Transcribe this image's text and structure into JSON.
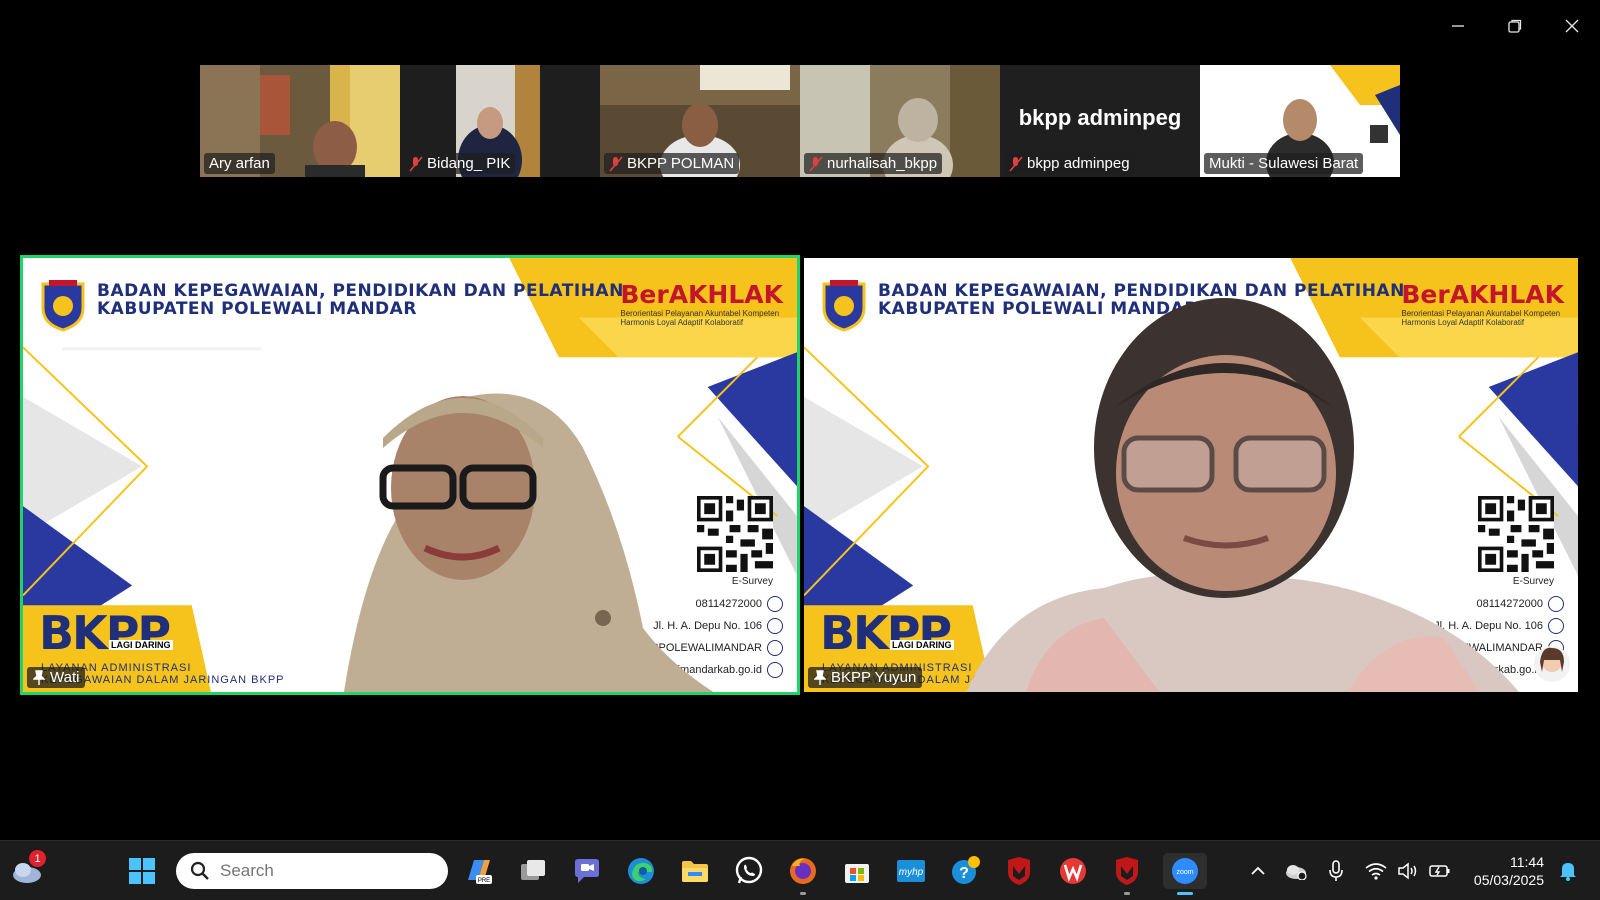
{
  "window": {
    "controls": [
      "minimize",
      "restore",
      "close"
    ]
  },
  "participants_strip": [
    {
      "name": "Ary arfan",
      "muted": false
    },
    {
      "name": "Bidang_ PIK",
      "muted": true
    },
    {
      "name": "BKPP POLMAN",
      "muted": true
    },
    {
      "name": "nurhalisah_bkpp",
      "muted": true
    },
    {
      "name": "bkpp adminpeg",
      "muted": true,
      "display_text": "bkpp adminpeg"
    },
    {
      "name": "Mukti - Sulawesi Barat",
      "muted": false
    }
  ],
  "main_tiles": [
    {
      "name": "Wati",
      "active_speaker": true
    },
    {
      "name": "BKPP Yuyun",
      "active_speaker": false
    }
  ],
  "background": {
    "org_line1": "BADAN KEPEGAWAIAN, PENDIDIKAN DAN PELATIHAN",
    "org_line2": "KABUPATEN POLEWALI MANDAR",
    "brand": "BerAKHLAK",
    "brand_sub": "Berorientasi Pelayanan Akuntabel Kompeten Harmonis Loyal Adaptif Kolaboratif",
    "bkpp": "BKPP",
    "lagi_daring": "LAGI DARING",
    "layanan_line1": "LAYANAN ADMINISTRASI",
    "layanan_line2": "KEPEGAWAIAN DALAM JARINGAN BKPP",
    "esurvey": "E-Survey",
    "phone": "08114272000",
    "address": "Jl. H. A. Depu No. 106",
    "social": "BKPPPOLEWALIMANDAR",
    "website": "bkpp.polewalimandarkab.go.id"
  },
  "taskbar": {
    "weather_badge": "1",
    "search_placeholder": "Search",
    "apps": [
      "start",
      "copilot",
      "task-view",
      "teams-chat",
      "edge",
      "file-explorer",
      "whatsapp",
      "firefox",
      "microsoft-store",
      "myhp",
      "get-help",
      "mcafee",
      "wps-office",
      "mcafee-security",
      "zoom"
    ],
    "time": "11:44",
    "date": "05/03/2025"
  },
  "colors": {
    "active_speaker_border": "#21d46a",
    "navy": "#1f2f7a",
    "yellow": "#f6c21c",
    "zoom_blue": "#2d8cff"
  }
}
